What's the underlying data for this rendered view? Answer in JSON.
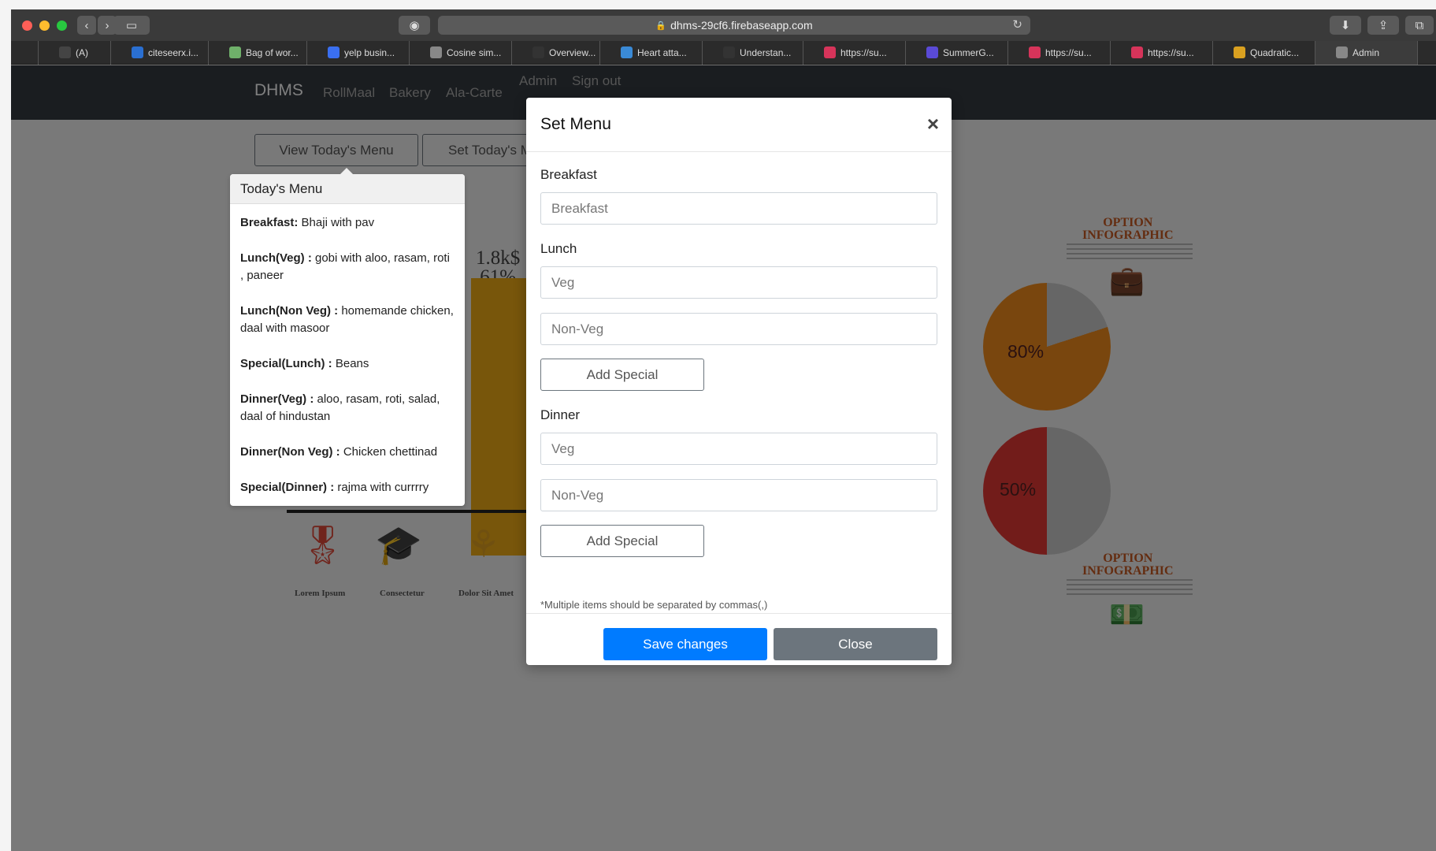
{
  "browser": {
    "url": "dhms-29cf6.firebaseapp.com",
    "bookmarks": [
      {
        "label": "",
        "color": "#2b2b2b"
      },
      {
        "label": "(A)",
        "color": "#444"
      },
      {
        "label": "citeseerx.i...",
        "color": "#2a6fd1"
      },
      {
        "label": "Bag of wor...",
        "color": "#6fb06a"
      },
      {
        "label": "yelp busin...",
        "color": "#3a6ff0"
      },
      {
        "label": "Cosine sim...",
        "color": "#888"
      },
      {
        "label": "Overview...",
        "color": "#333"
      },
      {
        "label": "Heart atta...",
        "color": "#3a8ad6"
      },
      {
        "label": "Understan...",
        "color": "#333"
      },
      {
        "label": "https://su...",
        "color": "#d6345a"
      },
      {
        "label": "SummerG...",
        "color": "#5a4ad6"
      },
      {
        "label": "https://su...",
        "color": "#d6345a"
      },
      {
        "label": "https://su...",
        "color": "#d6345a"
      },
      {
        "label": "Quadratic...",
        "color": "#d9a020"
      },
      {
        "label": "Admin",
        "color": "#888"
      }
    ]
  },
  "navbar": {
    "brand": "DHMS",
    "links": [
      "RollMaal",
      "Bakery",
      "Ala-Carte",
      "Admin",
      "Sign out"
    ]
  },
  "page": {
    "view_menu_button": "View Today's Menu",
    "set_menu_button": "Set Today's Menu"
  },
  "background": {
    "bar_label": "1.8k$\n61%",
    "captions": [
      "Lorem Ipsum",
      "Consectetur",
      "Dolor Sit Amet"
    ],
    "pie_top_label": "80%",
    "pie_bottom_label": "50%",
    "pie_top_value": 80,
    "pie_bottom_value": 50,
    "option_title": "OPTION\nINFOGRAPHIC"
  },
  "popover": {
    "title": "Today's Menu",
    "items": [
      {
        "label": "Breakfast:",
        "value": " Bhaji with pav"
      },
      {
        "label": "Lunch(Veg) :",
        "value": " gobi with aloo, rasam, roti , paneer"
      },
      {
        "label": "Lunch(Non Veg) :",
        "value": " homemande chicken, daal with masoor"
      },
      {
        "label": "Special(Lunch) :",
        "value": " Beans"
      },
      {
        "label": "Dinner(Veg) :",
        "value": " aloo, rasam, roti, salad, daal of hindustan"
      },
      {
        "label": "Dinner(Non Veg) :",
        "value": " Chicken chettinad"
      },
      {
        "label": "Special(Dinner) :",
        "value": " rajma with currrry"
      }
    ]
  },
  "modal": {
    "title": "Set Menu",
    "close_symbol": "×",
    "breakfast_label": "Breakfast",
    "breakfast_placeholder": "Breakfast",
    "lunch_label": "Lunch",
    "lunch_veg_placeholder": "Veg",
    "lunch_nonveg_placeholder": "Non-Veg",
    "add_special_lunch": "Add Special",
    "dinner_label": "Dinner",
    "dinner_veg_placeholder": "Veg",
    "dinner_nonveg_placeholder": "Non-Veg",
    "add_special_dinner": "Add Special",
    "note": "*Multiple items should be separated by commas(,)",
    "save_button": "Save changes",
    "close_button": "Close"
  },
  "colors": {
    "primary": "#007bff",
    "secondary": "#6c757d",
    "navbar": "#343a40",
    "orange": "#f28c1c",
    "red": "#e53935"
  }
}
